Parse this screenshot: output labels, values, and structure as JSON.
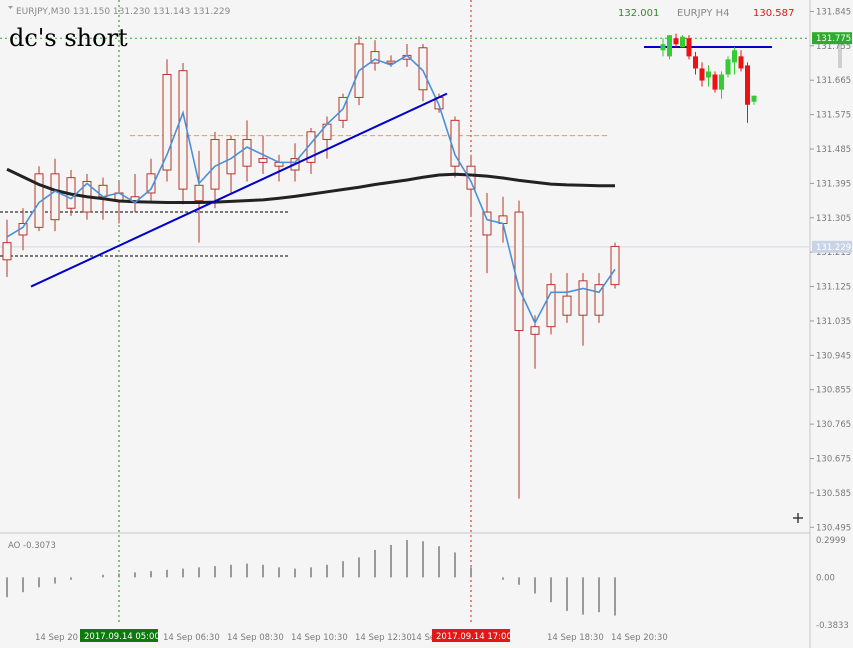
{
  "header": {
    "symbol_line": "EURJPY,M30  131.150 131.230 131.143 131.229",
    "annotation": "dc's short"
  },
  "colors": {
    "background": "#f5f5f5",
    "candle": "#b5382a",
    "ma_fast": "#4a90d9",
    "ma_slow": "#222222",
    "trendline": "#0000cc",
    "h4_bull": "#33cc33",
    "h4_bear": "#ee1111",
    "level_green": "#2eaa2e",
    "level_orange": "#f0a030",
    "date_green": "#0e7a0e",
    "date_red": "#e01818"
  },
  "h4_panel": {
    "title": "EURJPY H4",
    "high": "132.001",
    "low": "130.587",
    "level": 131.775
  },
  "chart_data": {
    "type": "candlestick",
    "symbol": "EURJPY",
    "timeframe": "M30",
    "ylim": [
      130.48,
      131.875
    ],
    "y_ticks": [
      131.845,
      131.755,
      131.665,
      131.575,
      131.485,
      131.395,
      131.305,
      131.215,
      131.125,
      131.035,
      130.945,
      130.855,
      130.765,
      130.675,
      130.585,
      130.495
    ],
    "current_price": 131.229,
    "x_labels": [
      "14 Sep 20",
      "2017.09.14 05:00",
      "14 Sep 06:30",
      "14 Sep 08:30",
      "14 Sep 10:30",
      "14 Sep 12:30",
      "14 Sep 1",
      "2017.09.14 17:00",
      "14 Sep 18:30",
      "14 Sep 20:30"
    ],
    "x_label_pos": [
      2,
      7,
      10,
      14,
      18,
      22,
      25.5,
      29,
      34,
      38
    ],
    "candles": [
      {
        "o": 131.24,
        "h": 131.3,
        "l": 131.15,
        "c": 131.195
      },
      {
        "o": 131.26,
        "h": 131.33,
        "l": 131.22,
        "c": 131.29
      },
      {
        "o": 131.28,
        "h": 131.44,
        "l": 131.27,
        "c": 131.42
      },
      {
        "o": 131.3,
        "h": 131.46,
        "l": 131.27,
        "c": 131.42
      },
      {
        "o": 131.41,
        "h": 131.43,
        "l": 131.31,
        "c": 131.33
      },
      {
        "o": 131.32,
        "h": 131.42,
        "l": 131.3,
        "c": 131.4
      },
      {
        "o": 131.39,
        "h": 131.41,
        "l": 131.3,
        "c": 131.36
      },
      {
        "o": 131.35,
        "h": 131.4,
        "l": 131.29,
        "c": 131.37
      },
      {
        "o": 131.36,
        "h": 131.42,
        "l": 131.32,
        "c": 131.35
      },
      {
        "o": 131.37,
        "h": 131.46,
        "l": 131.35,
        "c": 131.42
      },
      {
        "o": 131.43,
        "h": 131.72,
        "l": 131.4,
        "c": 131.68
      },
      {
        "o": 131.69,
        "h": 131.71,
        "l": 131.34,
        "c": 131.38
      },
      {
        "o": 131.35,
        "h": 131.48,
        "l": 131.24,
        "c": 131.39
      },
      {
        "o": 131.38,
        "h": 131.53,
        "l": 131.33,
        "c": 131.51
      },
      {
        "o": 131.51,
        "h": 131.52,
        "l": 131.37,
        "c": 131.42
      },
      {
        "o": 131.44,
        "h": 131.56,
        "l": 131.4,
        "c": 131.51
      },
      {
        "o": 131.46,
        "h": 131.52,
        "l": 131.42,
        "c": 131.45
      },
      {
        "o": 131.44,
        "h": 131.47,
        "l": 131.4,
        "c": 131.45
      },
      {
        "o": 131.43,
        "h": 131.5,
        "l": 131.4,
        "c": 131.46
      },
      {
        "o": 131.45,
        "h": 131.54,
        "l": 131.42,
        "c": 131.53
      },
      {
        "o": 131.51,
        "h": 131.57,
        "l": 131.46,
        "c": 131.55
      },
      {
        "o": 131.56,
        "h": 131.63,
        "l": 131.54,
        "c": 131.62
      },
      {
        "o": 131.62,
        "h": 131.78,
        "l": 131.6,
        "c": 131.76
      },
      {
        "o": 131.74,
        "h": 131.77,
        "l": 131.69,
        "c": 131.71
      },
      {
        "o": 131.71,
        "h": 131.73,
        "l": 131.7,
        "c": 131.715
      },
      {
        "o": 131.72,
        "h": 131.76,
        "l": 131.7,
        "c": 131.73
      },
      {
        "o": 131.75,
        "h": 131.76,
        "l": 131.61,
        "c": 131.64
      },
      {
        "o": 131.62,
        "h": 131.63,
        "l": 131.58,
        "c": 131.59
      },
      {
        "o": 131.56,
        "h": 131.57,
        "l": 131.41,
        "c": 131.44
      },
      {
        "o": 131.44,
        "h": 131.47,
        "l": 131.31,
        "c": 131.38
      },
      {
        "o": 131.32,
        "h": 131.37,
        "l": 131.16,
        "c": 131.26
      },
      {
        "o": 131.29,
        "h": 131.36,
        "l": 131.24,
        "c": 131.31
      },
      {
        "o": 131.32,
        "h": 131.35,
        "l": 130.57,
        "c": 131.01
      },
      {
        "o": 131.0,
        "h": 131.05,
        "l": 130.91,
        "c": 131.02
      },
      {
        "o": 131.02,
        "h": 131.16,
        "l": 131.0,
        "c": 131.13
      },
      {
        "o": 131.1,
        "h": 131.16,
        "l": 131.03,
        "c": 131.05
      },
      {
        "o": 131.05,
        "h": 131.16,
        "l": 130.97,
        "c": 131.14
      },
      {
        "o": 131.05,
        "h": 131.16,
        "l": 131.03,
        "c": 131.13
      },
      {
        "o": 131.13,
        "h": 131.24,
        "l": 131.12,
        "c": 131.23
      }
    ],
    "ma_fast": [
      131.255,
      131.28,
      131.345,
      131.375,
      131.355,
      131.395,
      131.36,
      131.37,
      131.345,
      131.38,
      131.47,
      131.58,
      131.395,
      131.44,
      131.46,
      131.49,
      131.47,
      131.45,
      131.45,
      131.5,
      131.55,
      131.59,
      131.69,
      131.72,
      131.705,
      131.73,
      131.69,
      131.6,
      131.47,
      131.4,
      131.3,
      131.29,
      131.12,
      131.03,
      131.11,
      131.11,
      131.12,
      131.11,
      131.17
    ],
    "ma_slow": [
      131.432,
      131.412,
      131.392,
      131.377,
      131.367,
      131.36,
      131.355,
      131.349,
      131.347,
      131.346,
      131.345,
      131.345,
      131.345,
      131.346,
      131.348,
      131.35,
      131.352,
      131.356,
      131.361,
      131.367,
      131.373,
      131.379,
      131.385,
      131.392,
      131.398,
      131.404,
      131.411,
      131.417,
      131.419,
      131.417,
      131.414,
      131.409,
      131.403,
      131.398,
      131.393,
      131.391,
      131.39,
      131.389,
      131.389
    ],
    "trendline": {
      "from": {
        "x": 1.5,
        "y": 131.125
      },
      "to": {
        "x": 27.5,
        "y": 131.63
      }
    },
    "levels": [
      {
        "y": 131.775,
        "style": "green-dotted",
        "label": "131.775"
      },
      {
        "y": 131.52,
        "style": "orange-dashed"
      },
      {
        "y": 131.32,
        "style": "black-dashed"
      },
      {
        "y": 131.205,
        "style": "black-dashed"
      }
    ],
    "vlines": [
      {
        "x": 7,
        "style": "green-dotted"
      },
      {
        "x": 29,
        "style": "red-dotted"
      }
    ],
    "ao": {
      "label": "AO -0.3073",
      "ylim": [
        -0.3833,
        0.2999
      ],
      "y_ticks": [
        0.2999,
        0.0,
        -0.3833
      ],
      "values": [
        -0.16,
        -0.12,
        -0.08,
        -0.05,
        -0.02,
        0.0,
        0.02,
        0.03,
        0.04,
        0.05,
        0.06,
        0.07,
        0.08,
        0.09,
        0.1,
        0.11,
        0.1,
        0.08,
        0.07,
        0.08,
        0.1,
        0.13,
        0.16,
        0.22,
        0.26,
        0.3,
        0.29,
        0.25,
        0.2,
        0.08,
        0.0,
        -0.02,
        -0.06,
        -0.13,
        -0.2,
        -0.27,
        -0.3,
        -0.28,
        -0.3073
      ]
    }
  },
  "h4_chart": {
    "type": "candlestick",
    "candles": [
      {
        "o": 131.78,
        "h": 131.82,
        "l": 131.76,
        "c": 131.8
      },
      {
        "o": 131.76,
        "h": 131.83,
        "l": 131.75,
        "c": 131.83
      },
      {
        "o": 131.82,
        "h": 131.835,
        "l": 131.79,
        "c": 131.8
      },
      {
        "o": 131.79,
        "h": 131.83,
        "l": 131.79,
        "c": 131.825
      },
      {
        "o": 131.82,
        "h": 131.83,
        "l": 131.75,
        "c": 131.76
      },
      {
        "o": 131.76,
        "h": 131.775,
        "l": 131.7,
        "c": 131.72
      },
      {
        "o": 131.72,
        "h": 131.74,
        "l": 131.66,
        "c": 131.68
      },
      {
        "o": 131.69,
        "h": 131.73,
        "l": 131.66,
        "c": 131.71
      },
      {
        "o": 131.7,
        "h": 131.71,
        "l": 131.64,
        "c": 131.65
      },
      {
        "o": 131.65,
        "h": 131.71,
        "l": 131.62,
        "c": 131.7
      },
      {
        "o": 131.7,
        "h": 131.76,
        "l": 131.69,
        "c": 131.75
      },
      {
        "o": 131.74,
        "h": 131.79,
        "l": 131.7,
        "c": 131.78
      },
      {
        "o": 131.76,
        "h": 131.78,
        "l": 131.71,
        "c": 131.72
      },
      {
        "o": 131.73,
        "h": 131.74,
        "l": 131.54,
        "c": 131.6
      },
      {
        "o": 131.61,
        "h": 131.63,
        "l": 131.6,
        "c": 131.63
      }
    ],
    "ylim": [
      131.5,
      131.9
    ]
  }
}
